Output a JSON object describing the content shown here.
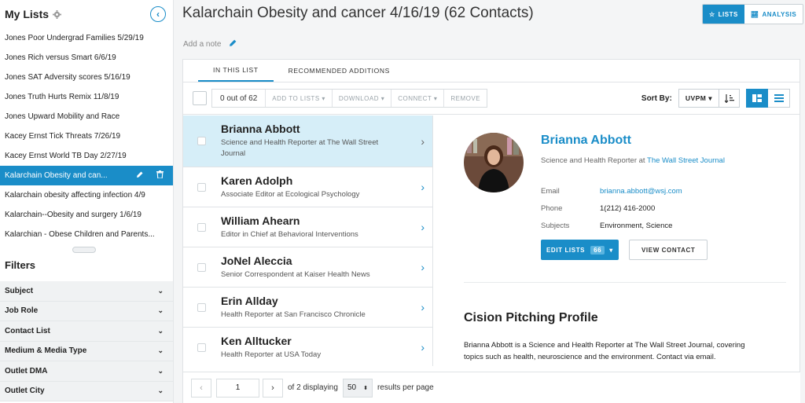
{
  "sidebar": {
    "title": "My Lists",
    "lists": [
      {
        "label": "Jones Poor Undergrad Families 5/29/19"
      },
      {
        "label": "Jones Rich versus Smart 6/6/19"
      },
      {
        "label": "Jones SAT Adversity scores 5/16/19"
      },
      {
        "label": "Jones Truth Hurts Remix 11/8/19"
      },
      {
        "label": "Jones Upward Mobility and Race"
      },
      {
        "label": "Kacey Ernst Tick Threats 7/26/19"
      },
      {
        "label": "Kacey Ernst World TB Day 2/27/19"
      },
      {
        "label": "Kalarchain Obesity and can..."
      },
      {
        "label": "Kalarchain obesity affecting infection 4/9"
      },
      {
        "label": "Kalarchain--Obesity and surgery 1/6/19"
      },
      {
        "label": "Kalarchian - Obese Children and Parents..."
      }
    ],
    "filters_title": "Filters",
    "filters": [
      {
        "label": "Subject"
      },
      {
        "label": "Job Role"
      },
      {
        "label": "Contact List"
      },
      {
        "label": "Medium & Media Type"
      },
      {
        "label": "Outlet DMA"
      },
      {
        "label": "Outlet City"
      }
    ]
  },
  "header": {
    "title": "Kalarchain Obesity and cancer 4/16/19 (62 Contacts)",
    "add_note": "Add a note",
    "lists_label": "LISTS",
    "analysis_label": "ANALYSIS"
  },
  "tabs": {
    "in_list": "IN THIS LIST",
    "recommended": "RECOMMENDED ADDITIONS"
  },
  "toolbar": {
    "count": "0 out of 62",
    "add_to_lists": "ADD TO LISTS ▾",
    "download": "DOWNLOAD ▾",
    "connect": "CONNECT ▾",
    "remove": "REMOVE",
    "sort_by": "Sort By:",
    "sort_value": "UVPM ▾"
  },
  "contacts": [
    {
      "name": "Brianna Abbott",
      "desc": "Science and Health Reporter at The Wall Street Journal"
    },
    {
      "name": "Karen Adolph",
      "desc": "Associate Editor at Ecological Psychology"
    },
    {
      "name": "William Ahearn",
      "desc": "Editor in Chief at Behavioral Interventions"
    },
    {
      "name": "JoNel Aleccia",
      "desc": "Senior Correspondent at Kaiser Health News"
    },
    {
      "name": "Erin Allday",
      "desc": "Health Reporter at San Francisco Chronicle"
    },
    {
      "name": "Ken Alltucker",
      "desc": "Health Reporter at USA Today"
    }
  ],
  "pager": {
    "page": "1",
    "of_text": "of 2 displaying",
    "per_page": "50",
    "per_page_label": "results per page"
  },
  "detail": {
    "name": "Brianna Abbott",
    "title_prefix": "Science and Health Reporter at",
    "outlet": "The Wall Street Journal",
    "email_label": "Email",
    "email": "brianna.abbott@wsj.com",
    "phone_label": "Phone",
    "phone": "1(212) 416-2000",
    "subjects_label": "Subjects",
    "subjects": "Environment, Science",
    "edit_lists": "EDIT LISTS",
    "edit_count": "66",
    "view_contact": "VIEW CONTACT",
    "profile_title": "Cision Pitching Profile",
    "profile_text": "Brianna Abbott is a Science and Health Reporter at The Wall Street Journal, covering topics such as health, neuroscience and the environment. Contact via email."
  },
  "colors": {
    "accent": "#1a8dc8",
    "selected_row": "#d6eef8"
  }
}
